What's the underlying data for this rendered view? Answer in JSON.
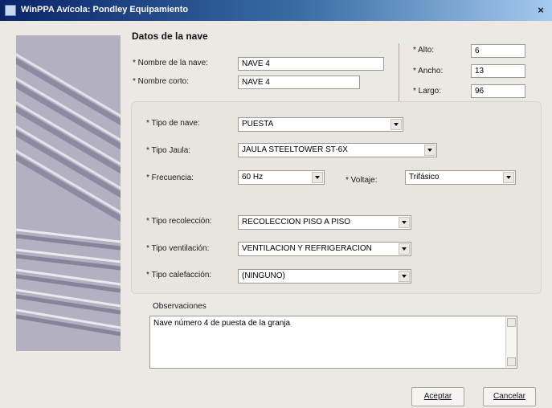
{
  "window": {
    "title": "WinPPA  Avícola: Pondley Equipamiento",
    "close_icon": "close-icon"
  },
  "section": {
    "title": "Datos de la nave"
  },
  "fields": {
    "nombre_nave": {
      "label": "* Nombre de la nave:",
      "value": "NAVE 4"
    },
    "nombre_corto": {
      "label": "* Nombre corto:",
      "value": "NAVE 4"
    },
    "alto": {
      "label": "* Alto:",
      "value": "6"
    },
    "ancho": {
      "label": "* Ancho:",
      "value": "13"
    },
    "largo": {
      "label": "* Largo:",
      "value": "96"
    }
  },
  "selects": {
    "tipo_nave": {
      "label": "* Tipo de nave:",
      "value": "PUESTA"
    },
    "tipo_jaula": {
      "label": "* Tipo Jaula:",
      "value": "JAULA STEELTOWER ST-6X"
    },
    "frecuencia": {
      "label": "* Frecuencia:",
      "value": "60 Hz"
    },
    "voltaje": {
      "label": "* Voltaje:",
      "value": "Trifásico"
    },
    "tipo_recoleccion": {
      "label": "* Tipo recolección:",
      "value": "RECOLECCION PISO A PISO"
    },
    "tipo_ventilacion": {
      "label": "* Tipo ventilación:",
      "value": "VENTILACION Y REFRIGERACION"
    },
    "tipo_calefaccion": {
      "label": "* Tipo calefacción:",
      "value": "(NINGUNO)"
    }
  },
  "observaciones": {
    "label": "Observaciones",
    "value": "Nave número 4 de puesta de la granja"
  },
  "buttons": {
    "aceptar": "Aceptar",
    "cancelar": "Cancelar"
  }
}
